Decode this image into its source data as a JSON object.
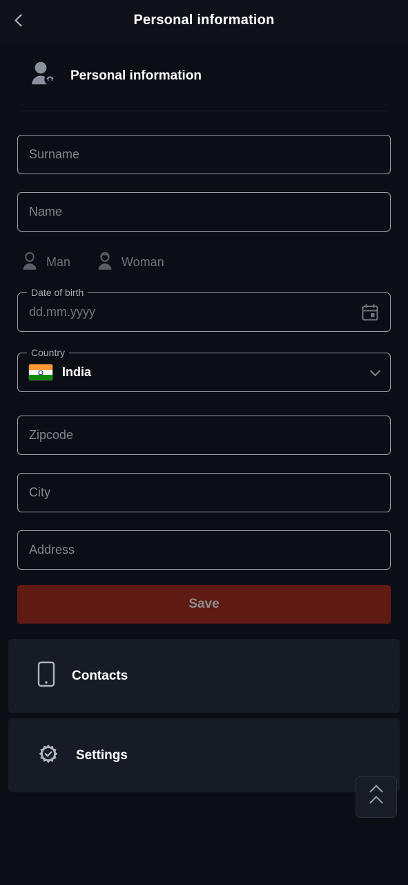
{
  "appbar": {
    "title": "Personal information",
    "back_icon": "chevron-left-icon"
  },
  "section": {
    "title": "Personal information",
    "icon": "user-settings-icon"
  },
  "form": {
    "surname": {
      "placeholder": "Surname",
      "value": ""
    },
    "name": {
      "placeholder": "Name",
      "value": ""
    },
    "gender": {
      "options": [
        {
          "label": "Man",
          "icon": "man-icon",
          "selected": false
        },
        {
          "label": "Woman",
          "icon": "woman-icon",
          "selected": false
        }
      ]
    },
    "date_of_birth": {
      "label": "Date of birth",
      "placeholder": "dd.mm.yyyy",
      "value": "",
      "icon": "calendar-icon"
    },
    "country": {
      "label": "Country",
      "value": "India",
      "flag": "india-flag-icon",
      "icon": "chevron-down-icon"
    },
    "zipcode": {
      "placeholder": "Zipcode",
      "value": ""
    },
    "city": {
      "placeholder": "City",
      "value": ""
    },
    "address": {
      "placeholder": "Address",
      "value": ""
    },
    "save": {
      "label": "Save",
      "enabled": false,
      "color": "#5e1a13",
      "text_color": "#8b8b8b"
    }
  },
  "menu": {
    "items": [
      {
        "label": "Contacts",
        "icon": "smartphone-icon"
      },
      {
        "label": "Settings",
        "icon": "gear-check-icon"
      }
    ]
  },
  "fab": {
    "icon": "double-chevron-up-icon"
  },
  "colors": {
    "background": "#0b0e14",
    "appbar": "#0e1117",
    "card": "#161b26",
    "field_border": "#9aa0a8",
    "placeholder": "#7f858e",
    "accent_red": "#5e1a13"
  }
}
